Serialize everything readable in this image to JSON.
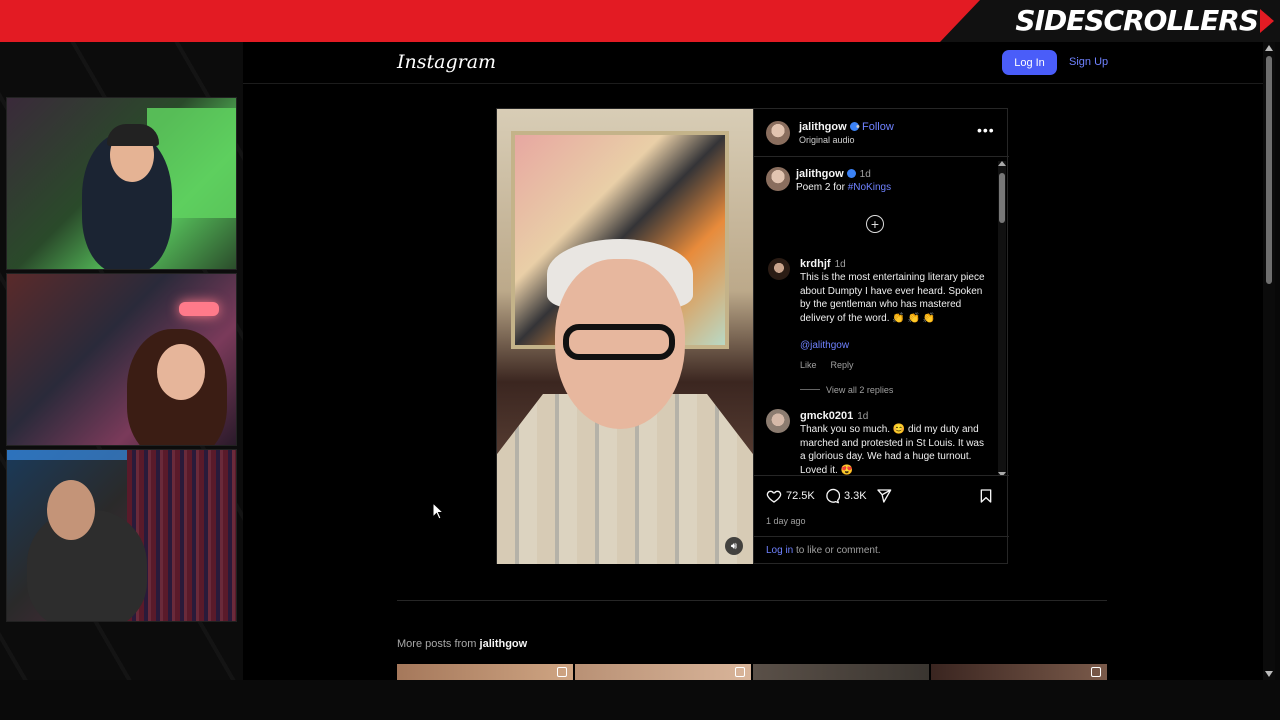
{
  "stream": {
    "brand_part1": "SIDE",
    "brand_part2": "SCROLLERS"
  },
  "instagram": {
    "logo": "Instagram",
    "login_label": "Log In",
    "signup_label": "Sign Up",
    "post": {
      "author": "jalithgow",
      "follow_label": "Follow",
      "audio": "Original audio",
      "caption_time": "1d",
      "caption_text": "Poem 2 for ",
      "caption_hashtag": "#NoKings",
      "comments": [
        {
          "user": "krdhjf",
          "time": "1d",
          "text": "This is the most entertaining literary piece about Dumpty I have ever heard. Spoken by the gentleman who has mastered delivery of the word. 👏 👏 👏",
          "mention": "@jalithgow",
          "like_label": "Like",
          "reply_label": "Reply",
          "view_replies": "View all 2 replies"
        },
        {
          "user": "gmck0201",
          "time": "1d",
          "text": "Thank you so much. 😊 did my duty and marched and protested in St Louis. It was a glorious day. We had a huge turnout. Loved it. 😍"
        }
      ],
      "likes": "72.5K",
      "comment_count": "3.3K",
      "posted": "1 day ago",
      "login_link": "Log in",
      "login_suffix": " to like or comment."
    },
    "more_posts_prefix": "More posts from ",
    "more_posts_user": "jalithgow"
  },
  "colors": {
    "banner_red": "#e31b23",
    "ig_blue": "#4a5df9",
    "link_blue": "#6f82ff"
  }
}
